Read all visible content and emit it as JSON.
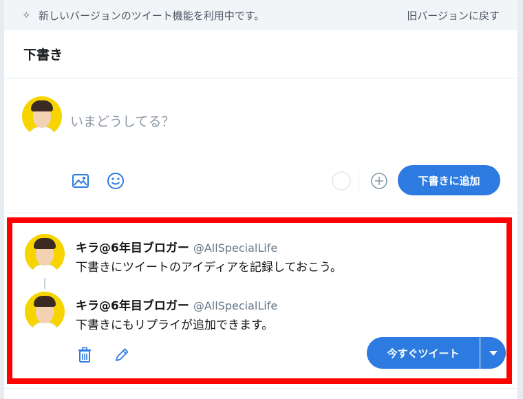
{
  "banner": {
    "message": "新しいバージョンのツイート機能を利用中です。",
    "revert_link": "旧バージョンに戻す",
    "sparkle_icon": "sparkle-icon"
  },
  "header": {
    "title": "下書き"
  },
  "composer": {
    "placeholder": "いまどうしてる？",
    "add_draft_label": "下書きに追加",
    "icons": [
      "media-icon",
      "emoji-icon",
      "progress-circle",
      "add-icon"
    ]
  },
  "drafts": {
    "thread": [
      {
        "name": "キラ@6年目ブロガー",
        "handle": "@AllSpecialLife",
        "text": "下書きにツイートのアイディアを記録しておこう。"
      },
      {
        "name": "キラ@6年目ブロガー",
        "handle": "@AllSpecialLife",
        "text": "下書きにもリプライが追加できます。"
      }
    ],
    "tweet_now_label": "今すぐツイート",
    "icons": [
      "trash-icon",
      "pencil-icon",
      "chevron-down-icon"
    ]
  },
  "colors": {
    "accent": "#2d7be0",
    "highlight": "#ff0000",
    "banner_bg": "#f2f5f8"
  }
}
